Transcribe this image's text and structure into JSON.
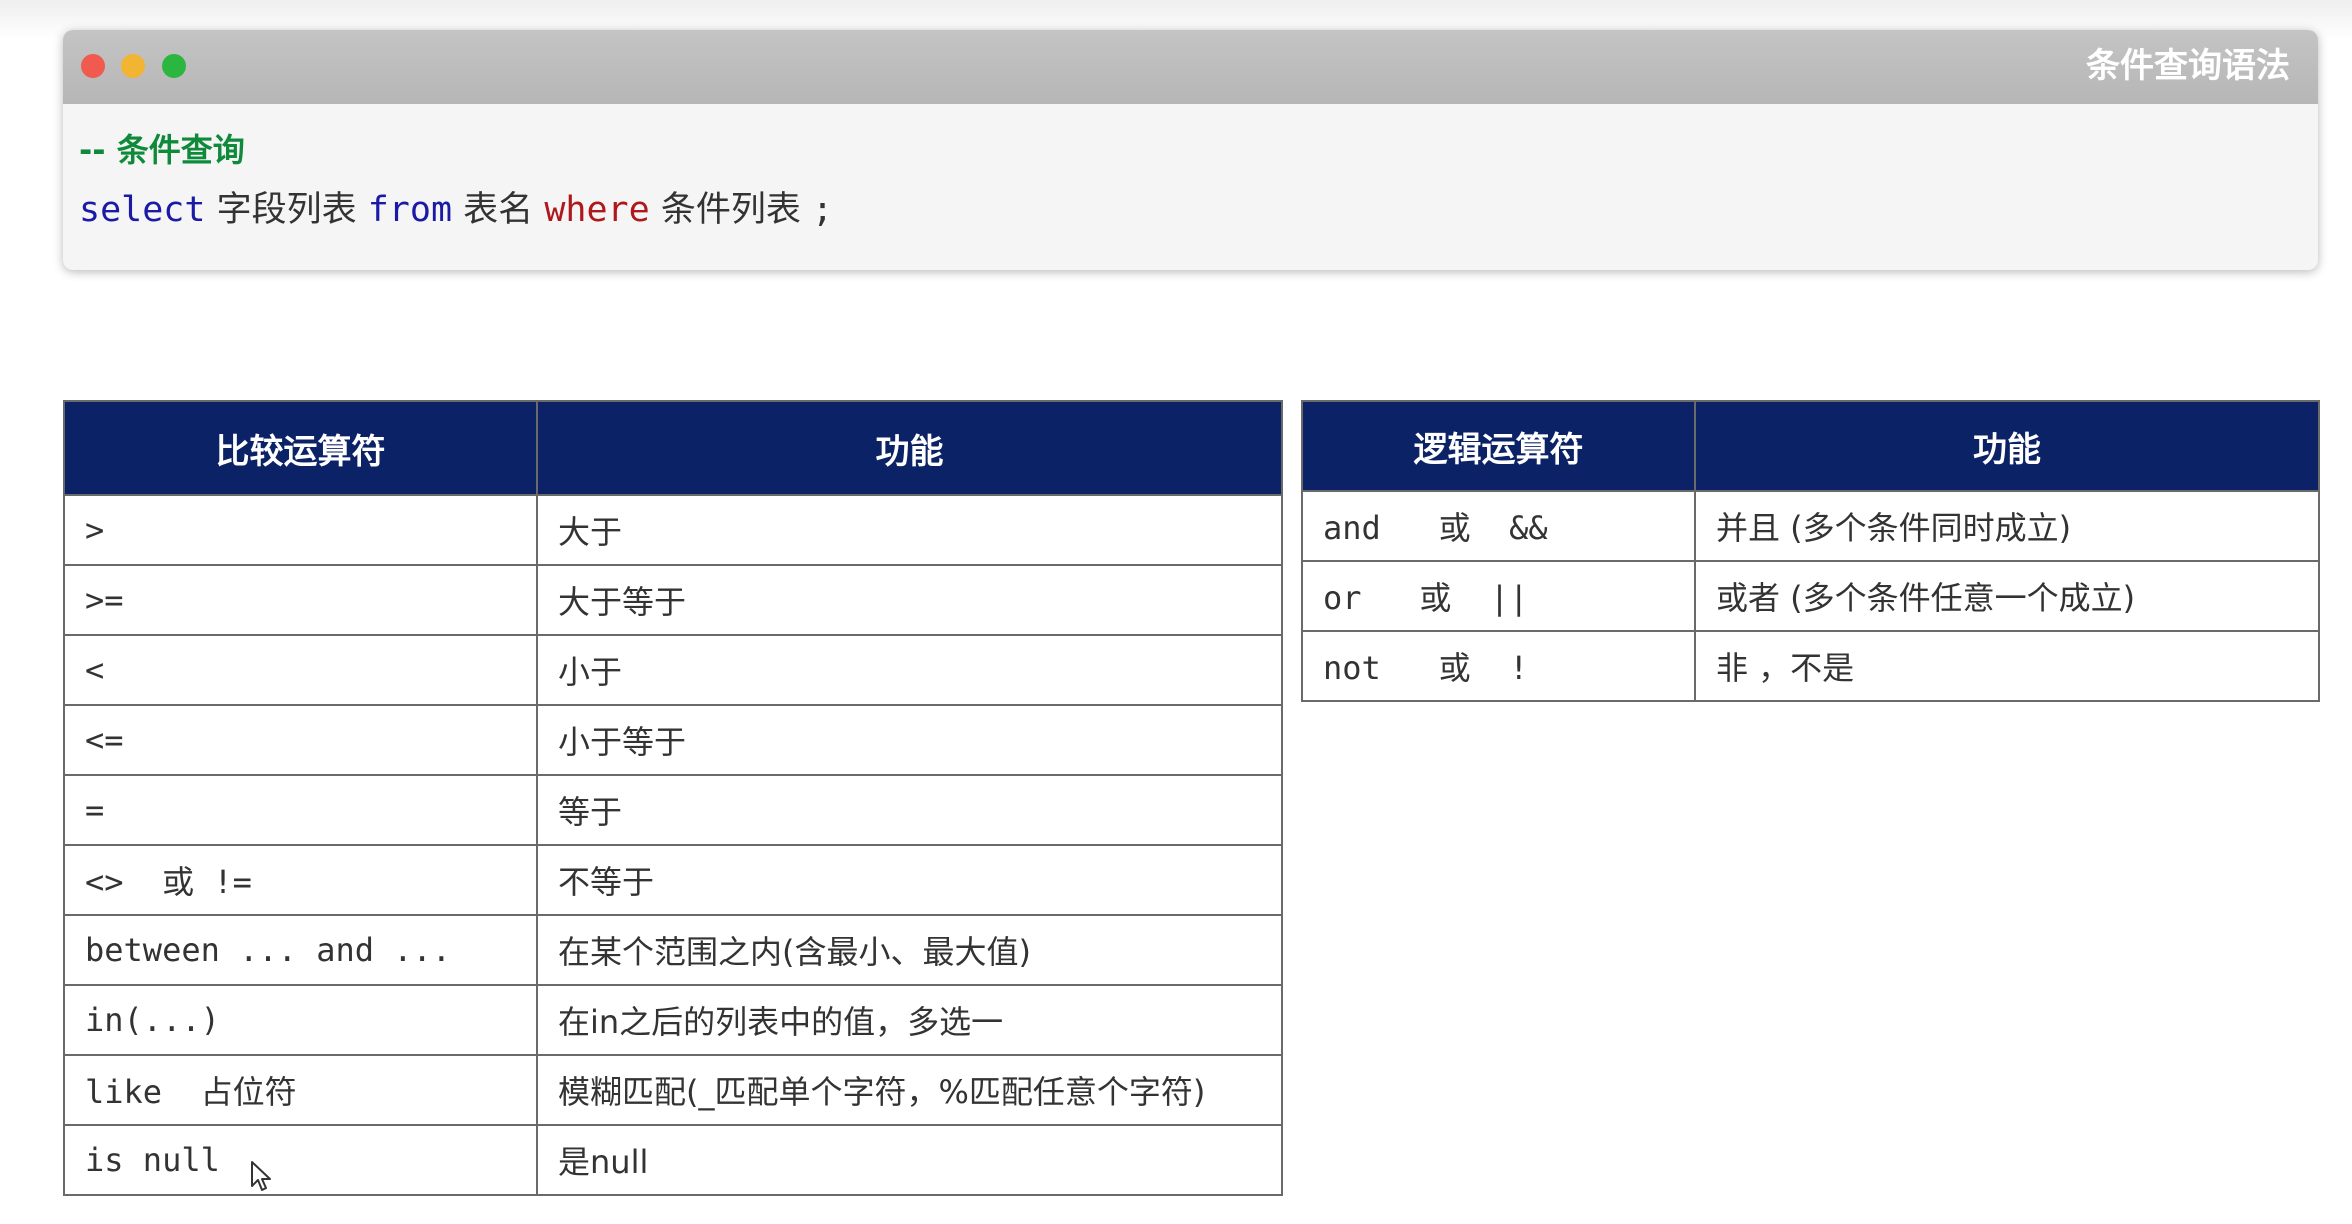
{
  "window": {
    "title": "条件查询语法",
    "controls": [
      "close",
      "minimize",
      "maximize"
    ]
  },
  "code": {
    "comment": "-- 条件查询",
    "tokens": {
      "select": "select",
      "field_list": "字段列表",
      "from": "from",
      "table_name": "表名",
      "where": "where",
      "condition_list": "条件列表",
      "semicolon": ";"
    }
  },
  "comparison_table": {
    "headers": [
      "比较运算符",
      "功能"
    ],
    "rows": [
      {
        "op": ">",
        "fn": "大于"
      },
      {
        "op": ">=",
        "fn": "大于等于"
      },
      {
        "op": "<",
        "fn": "小于"
      },
      {
        "op": "<=",
        "fn": "小于等于"
      },
      {
        "op": "=",
        "fn": "等于"
      },
      {
        "op": "<>  或 !=",
        "fn": "不等于"
      },
      {
        "op": "between ... and ...",
        "fn": "在某个范围之内(含最小、最大值)"
      },
      {
        "op": "in(...)",
        "fn": "在in之后的列表中的值，多选一"
      },
      {
        "op": "like  占位符",
        "fn": "模糊匹配(_匹配单个字符，%匹配任意个字符)"
      },
      {
        "op": "is null",
        "fn": "是null"
      }
    ]
  },
  "logical_table": {
    "headers": [
      "逻辑运算符",
      "功能"
    ],
    "rows": [
      {
        "op": "and   或  &&",
        "fn": "并且 (多个条件同时成立)"
      },
      {
        "op": "or   或  ||",
        "fn": "或者 (多个条件任意一个成立)"
      },
      {
        "op": "not   或  !",
        "fn": "非 ，不是"
      }
    ]
  },
  "colors": {
    "header_bg": "#0b2266",
    "keyword": "#1a1aa6",
    "where_keyword": "#b0171b",
    "comment": "#0f8a3a",
    "close_dot": "#f05a4f",
    "minimize_dot": "#f2b533",
    "maximize_dot": "#2bb63f"
  },
  "icons": {
    "cursor": "mouse-pointer-icon"
  }
}
